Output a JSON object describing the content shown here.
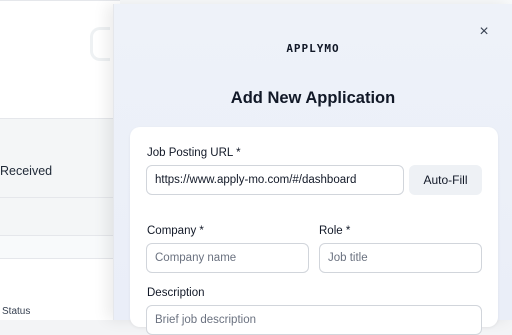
{
  "background": {
    "received_text": "Received",
    "status_text": "Status"
  },
  "modal": {
    "logo_text": "APPLYMO",
    "title": "Add New Application",
    "close_glyph": "×"
  },
  "form": {
    "job_url": {
      "label": "Job Posting URL *",
      "value": "https://www.apply-mo.com/#/dashboard"
    },
    "autofill_label": "Auto-Fill",
    "company": {
      "label": "Company *",
      "placeholder": "Company name"
    },
    "role": {
      "label": "Role *",
      "placeholder": "Job title"
    },
    "description": {
      "label": "Description",
      "placeholder": "Brief job description"
    }
  }
}
